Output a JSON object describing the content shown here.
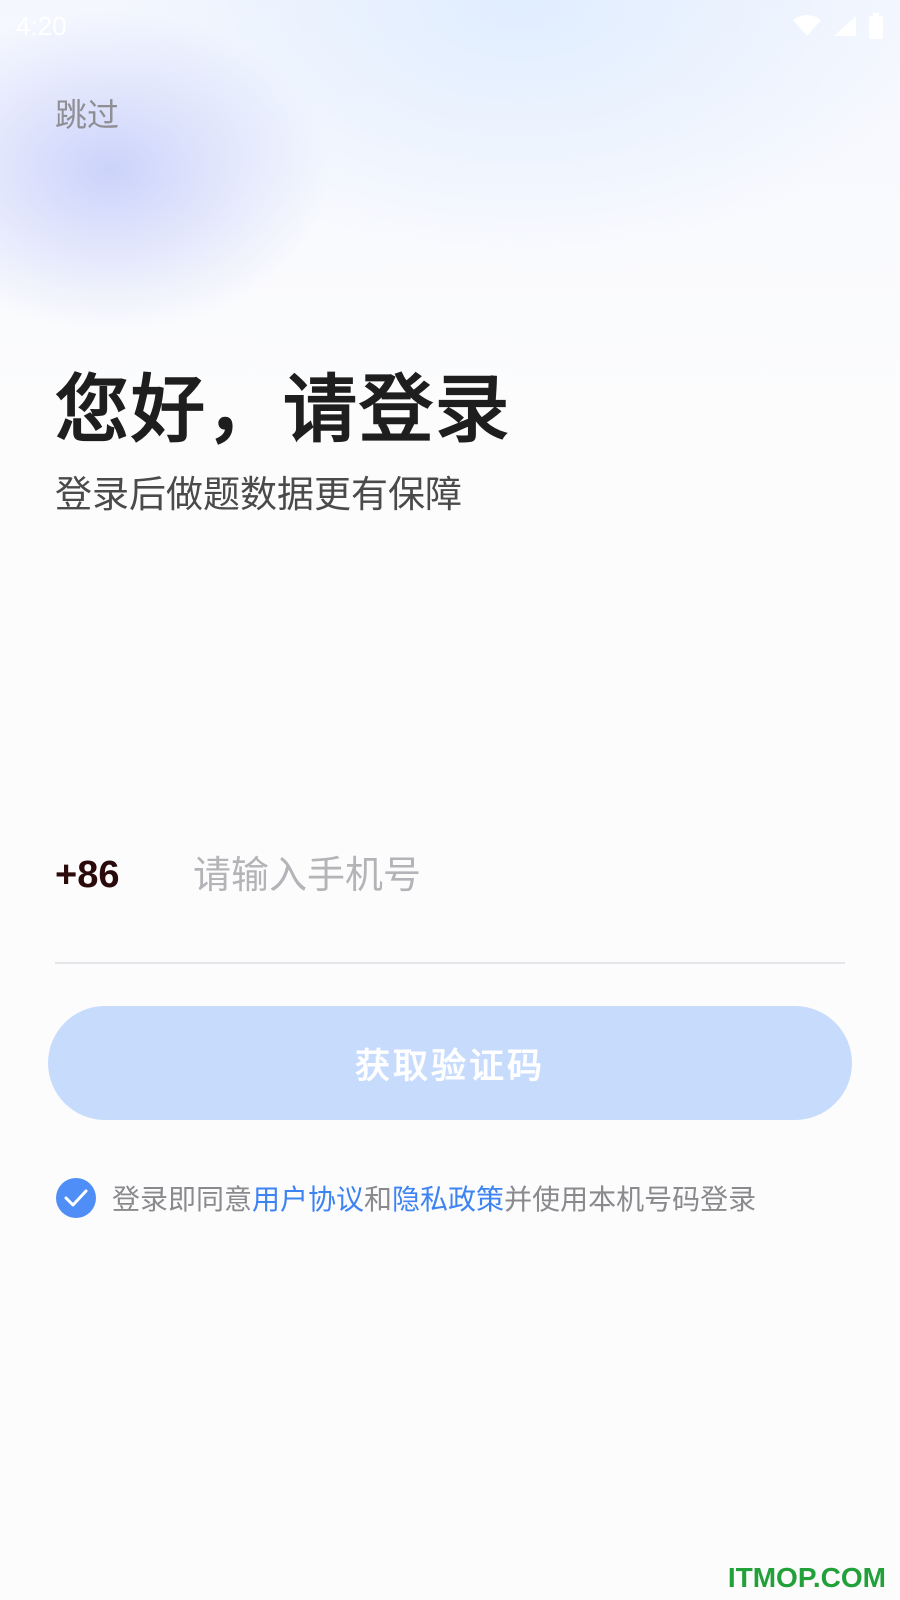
{
  "status_bar": {
    "time": "4:20",
    "icons": [
      "wifi-icon",
      "signal-icon",
      "battery-icon"
    ]
  },
  "header": {
    "skip_label": "跳过"
  },
  "main": {
    "title": "您好，请登录",
    "subtitle": "登录后做题数据更有保障"
  },
  "phone": {
    "country_code": "+86",
    "placeholder": "请输入手机号",
    "value": ""
  },
  "actions": {
    "get_code_label": "获取验证码"
  },
  "agreement": {
    "checked": true,
    "prefix": "登录即同意",
    "user_agreement": "用户协议",
    "and": "和",
    "privacy_policy": "隐私政策",
    "suffix": "并使用本机号码登录"
  },
  "watermark": "ITMOP.COM",
  "colors": {
    "accent": "#4f8ef7",
    "link": "#3d83f2",
    "button_disabled": "#c7dbfd",
    "title": "#1e1e1e",
    "watermark": "#22a13a"
  }
}
